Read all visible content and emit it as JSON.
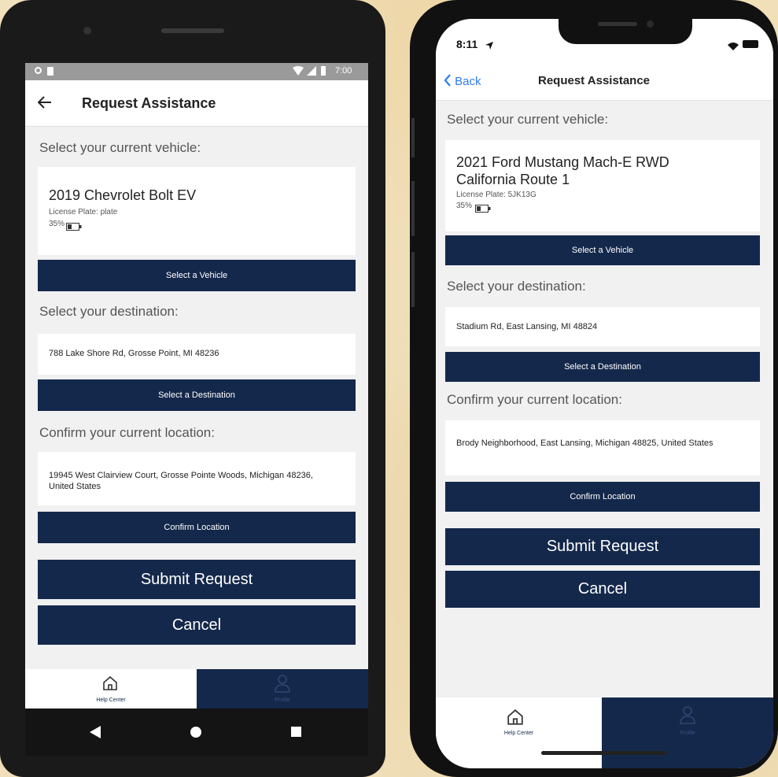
{
  "android": {
    "status_time": "7:00",
    "header_title": "Request Assistance",
    "vehicle_label": "Select your current vehicle:",
    "vehicle_name": "2019 Chevrolet Bolt EV",
    "vehicle_plate": "License Plate: plate",
    "vehicle_battery": "35%",
    "select_vehicle_button": "Select a Vehicle",
    "destination_label": "Select your destination:",
    "destination_value": "788 Lake Shore Rd, Grosse Point, MI 48236",
    "select_destination_button": "Select a Destination",
    "location_label": "Confirm your current location:",
    "location_value": "19945 West Clairview Court, Grosse Pointe Woods, Michigan 48236, United States",
    "confirm_location_button": "Confirm Location",
    "submit_button": "Submit Request",
    "cancel_button": "Cancel",
    "tab_help": "Help Center",
    "tab_profile": "Profile"
  },
  "iphone": {
    "status_time": "8:11",
    "back_label": "Back",
    "header_title": "Request Assistance",
    "vehicle_label": "Select your current vehicle:",
    "vehicle_name_line1": "2021 Ford Mustang Mach-E RWD",
    "vehicle_name_line2": "California Route 1",
    "vehicle_plate": "License Plate: 5JK13G",
    "vehicle_battery": "35%",
    "select_vehicle_button": "Select a Vehicle",
    "destination_label": "Select your destination:",
    "destination_value": "Stadium Rd, East Lansing, MI 48824",
    "select_destination_button": "Select a Destination",
    "location_label": "Confirm your current location:",
    "location_value": "Brody Neighborhood, East Lansing, Michigan 48825, United States",
    "confirm_location_button": "Confirm Location",
    "submit_button": "Submit Request",
    "cancel_button": "Cancel",
    "tab_help": "Help Center",
    "tab_profile": "Profile"
  },
  "colors": {
    "navy": "#14284b",
    "screen_bg": "#f1f1f1",
    "background": "#f0dfb8"
  }
}
